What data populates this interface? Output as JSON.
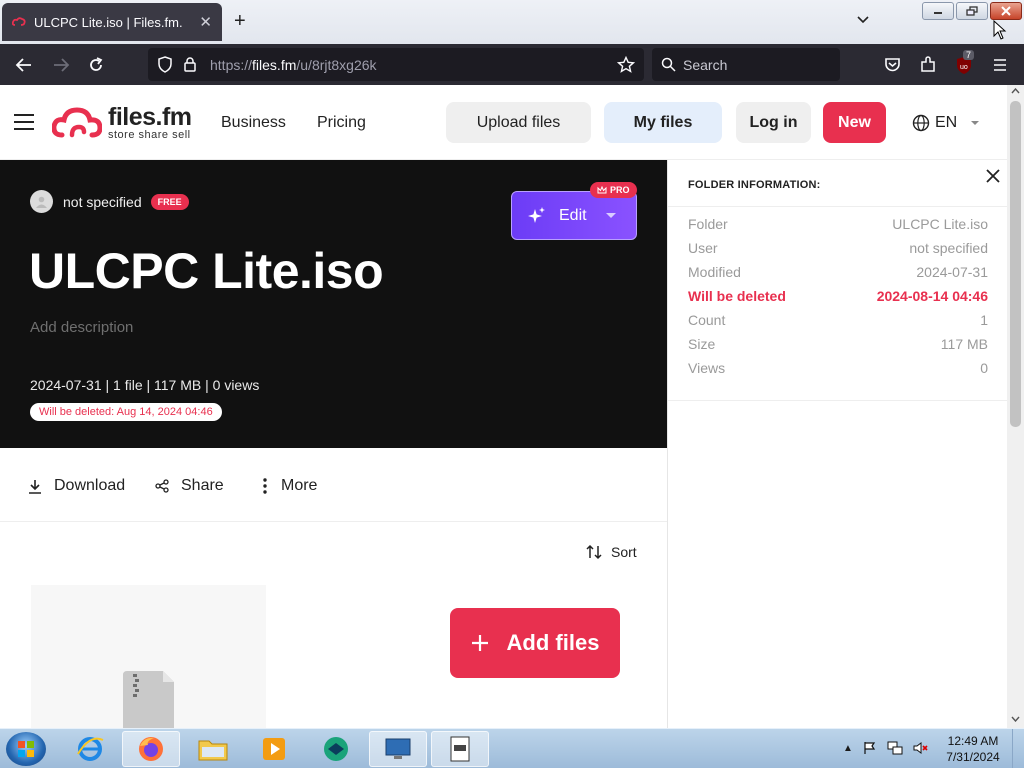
{
  "browser": {
    "tab_title": "ULCPC Lite.iso | Files.fm.",
    "url_prefix": "https://",
    "url_host": "files.fm",
    "url_path": "/u/8rjt8xg26k",
    "search_placeholder": "Search",
    "extension_badge": "7"
  },
  "header": {
    "logo_name": "files.fm",
    "logo_tagline": "store share sell",
    "nav": [
      "Business",
      "Pricing"
    ],
    "upload_label": "Upload files",
    "myfiles_label": "My files",
    "login_label": "Log in",
    "new_label": "New",
    "language": "EN"
  },
  "hero": {
    "owner": "not specified",
    "owner_badge": "FREE",
    "edit_label": "Edit",
    "pro_badge": "PRO",
    "title": "ULCPC Lite.iso",
    "description_placeholder": "Add description",
    "meta": "2024-07-31 | 1 file | 117 MB | 0 views",
    "delete_notice": "Will be deleted: Aug 14, 2024 04:46"
  },
  "actions": {
    "download": "Download",
    "share": "Share",
    "more": "More",
    "sort": "Sort",
    "add_files": "Add files"
  },
  "panel": {
    "title": "FOLDER INFORMATION:",
    "rows": [
      {
        "label": "Folder",
        "value": "ULCPC Lite.iso"
      },
      {
        "label": "User",
        "value": "not specified"
      },
      {
        "label": "Modified",
        "value": "2024-07-31"
      },
      {
        "label": "Will be deleted",
        "value": "2024-08-14 04:46"
      },
      {
        "label": "Count",
        "value": "1"
      },
      {
        "label": "Size",
        "value": "117 MB"
      },
      {
        "label": "Views",
        "value": "0"
      }
    ]
  },
  "taskbar": {
    "time": "12:49 AM",
    "date": "7/31/2024"
  },
  "colors": {
    "brand_red": "#e8304f",
    "edit_purple": "#6c3cf6",
    "hero_bg": "#111111"
  }
}
